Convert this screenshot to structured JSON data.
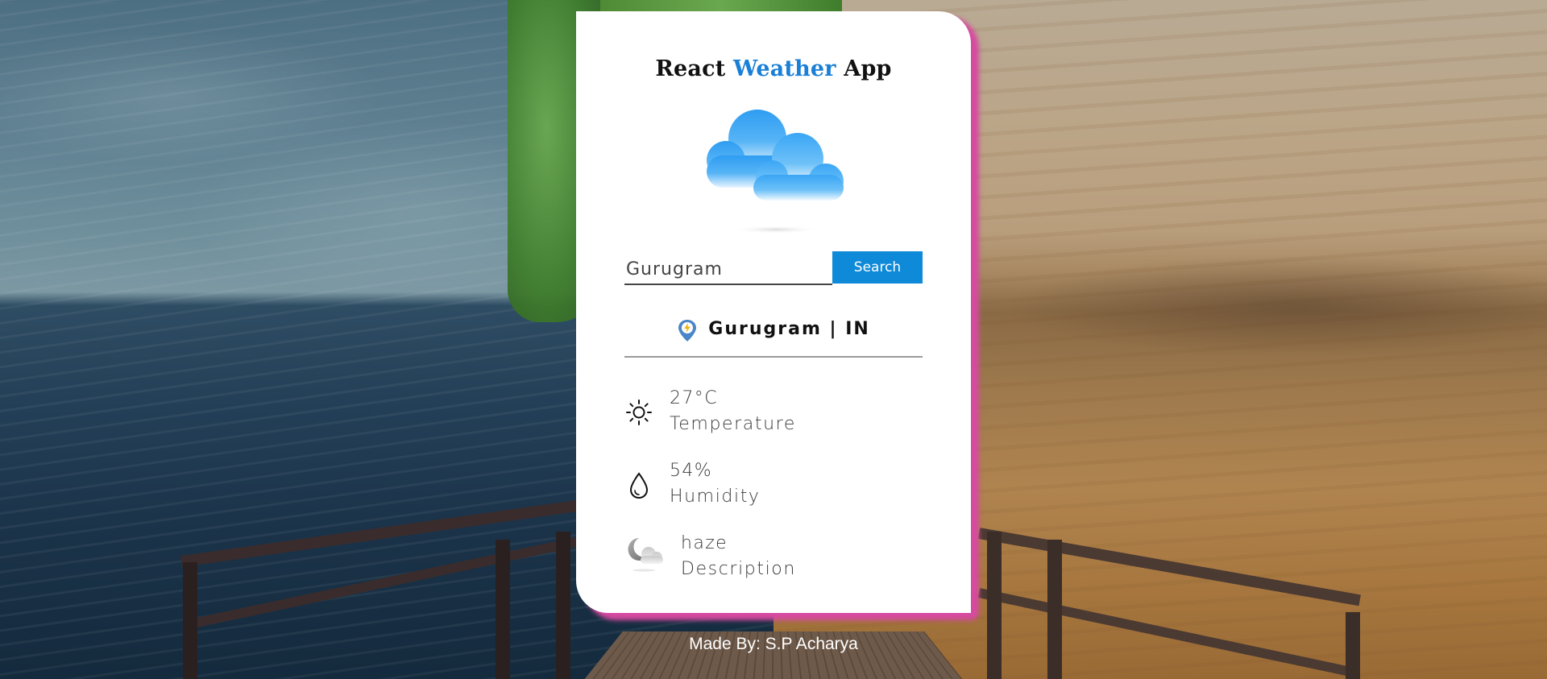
{
  "app": {
    "title_part1": "React ",
    "title_accent": "Weather",
    "title_part2": " App"
  },
  "search": {
    "value": "Gurugram",
    "placeholder": "",
    "button_label": "Search"
  },
  "location": {
    "icon": "location-pin-icon",
    "text": "Gurugram | IN"
  },
  "stats": {
    "temperature": {
      "icon": "sun-icon",
      "value": "27°C",
      "label": "Temperature"
    },
    "humidity": {
      "icon": "droplet-icon",
      "value": "54%",
      "label": "Humidity"
    },
    "description": {
      "icon": "haze-icon",
      "value": "haze",
      "label": "Description"
    }
  },
  "footer": {
    "text": "Made By: S.P Acharya"
  },
  "colors": {
    "accent": "#1a7fd6",
    "button": "#0e8ad8",
    "card_glow": "#d64aa0"
  }
}
